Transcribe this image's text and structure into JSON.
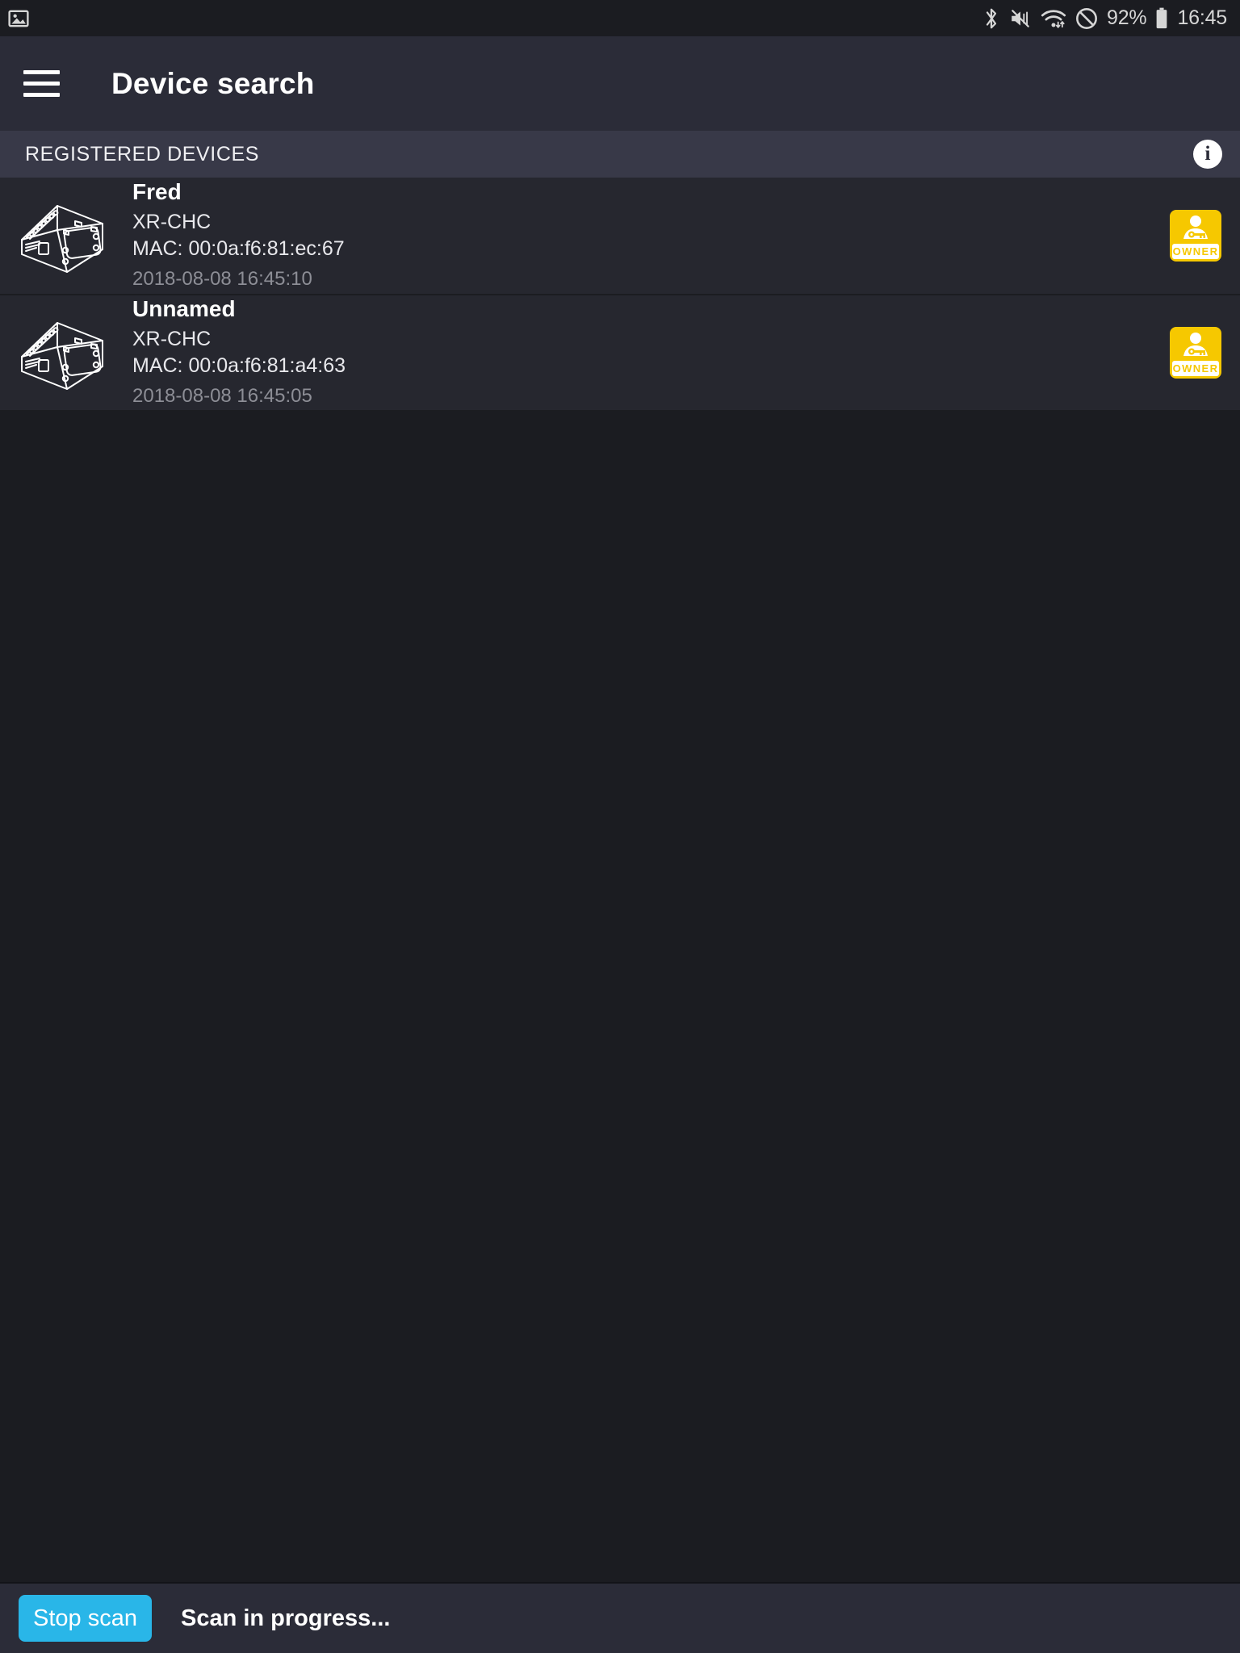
{
  "status_bar": {
    "left_icons": [
      "image-icon"
    ],
    "right_icons": [
      "bluetooth-icon",
      "vibrate-mute-icon",
      "wifi-icon",
      "do-not-disturb-icon"
    ],
    "battery_percent": "92%",
    "clock": "16:45"
  },
  "app_bar": {
    "menu_icon": "hamburger-menu-icon",
    "title": "Device search"
  },
  "section": {
    "title": "REGISTERED DEVICES",
    "info_icon": "info-icon",
    "info_label": "i"
  },
  "devices": [
    {
      "thumb_icon": "controller-device-icon",
      "name": "Fred",
      "model": "XR-CHC",
      "mac": "MAC: 00:0a:f6:81:ec:67",
      "timestamp": "2018-08-08 16:45:10",
      "badge": {
        "icon": "owner-key-icon",
        "label": "OWNER"
      }
    },
    {
      "thumb_icon": "controller-device-icon",
      "name": "Unnamed",
      "model": "XR-CHC",
      "mac": "MAC: 00:0a:f6:81:a4:63",
      "timestamp": "2018-08-08 16:45:05",
      "badge": {
        "icon": "owner-key-icon",
        "label": "OWNER"
      }
    }
  ],
  "bottom_bar": {
    "stop_button": "Stop scan",
    "status_text": "Scan in progress..."
  },
  "colors": {
    "background": "#1b1c21",
    "app_bar": "#2b2c38",
    "section_header": "#383948",
    "row": "#26272f",
    "accent_blue": "#29b6e8",
    "badge_yellow": "#f6c800",
    "muted_text": "#8d8e96"
  }
}
